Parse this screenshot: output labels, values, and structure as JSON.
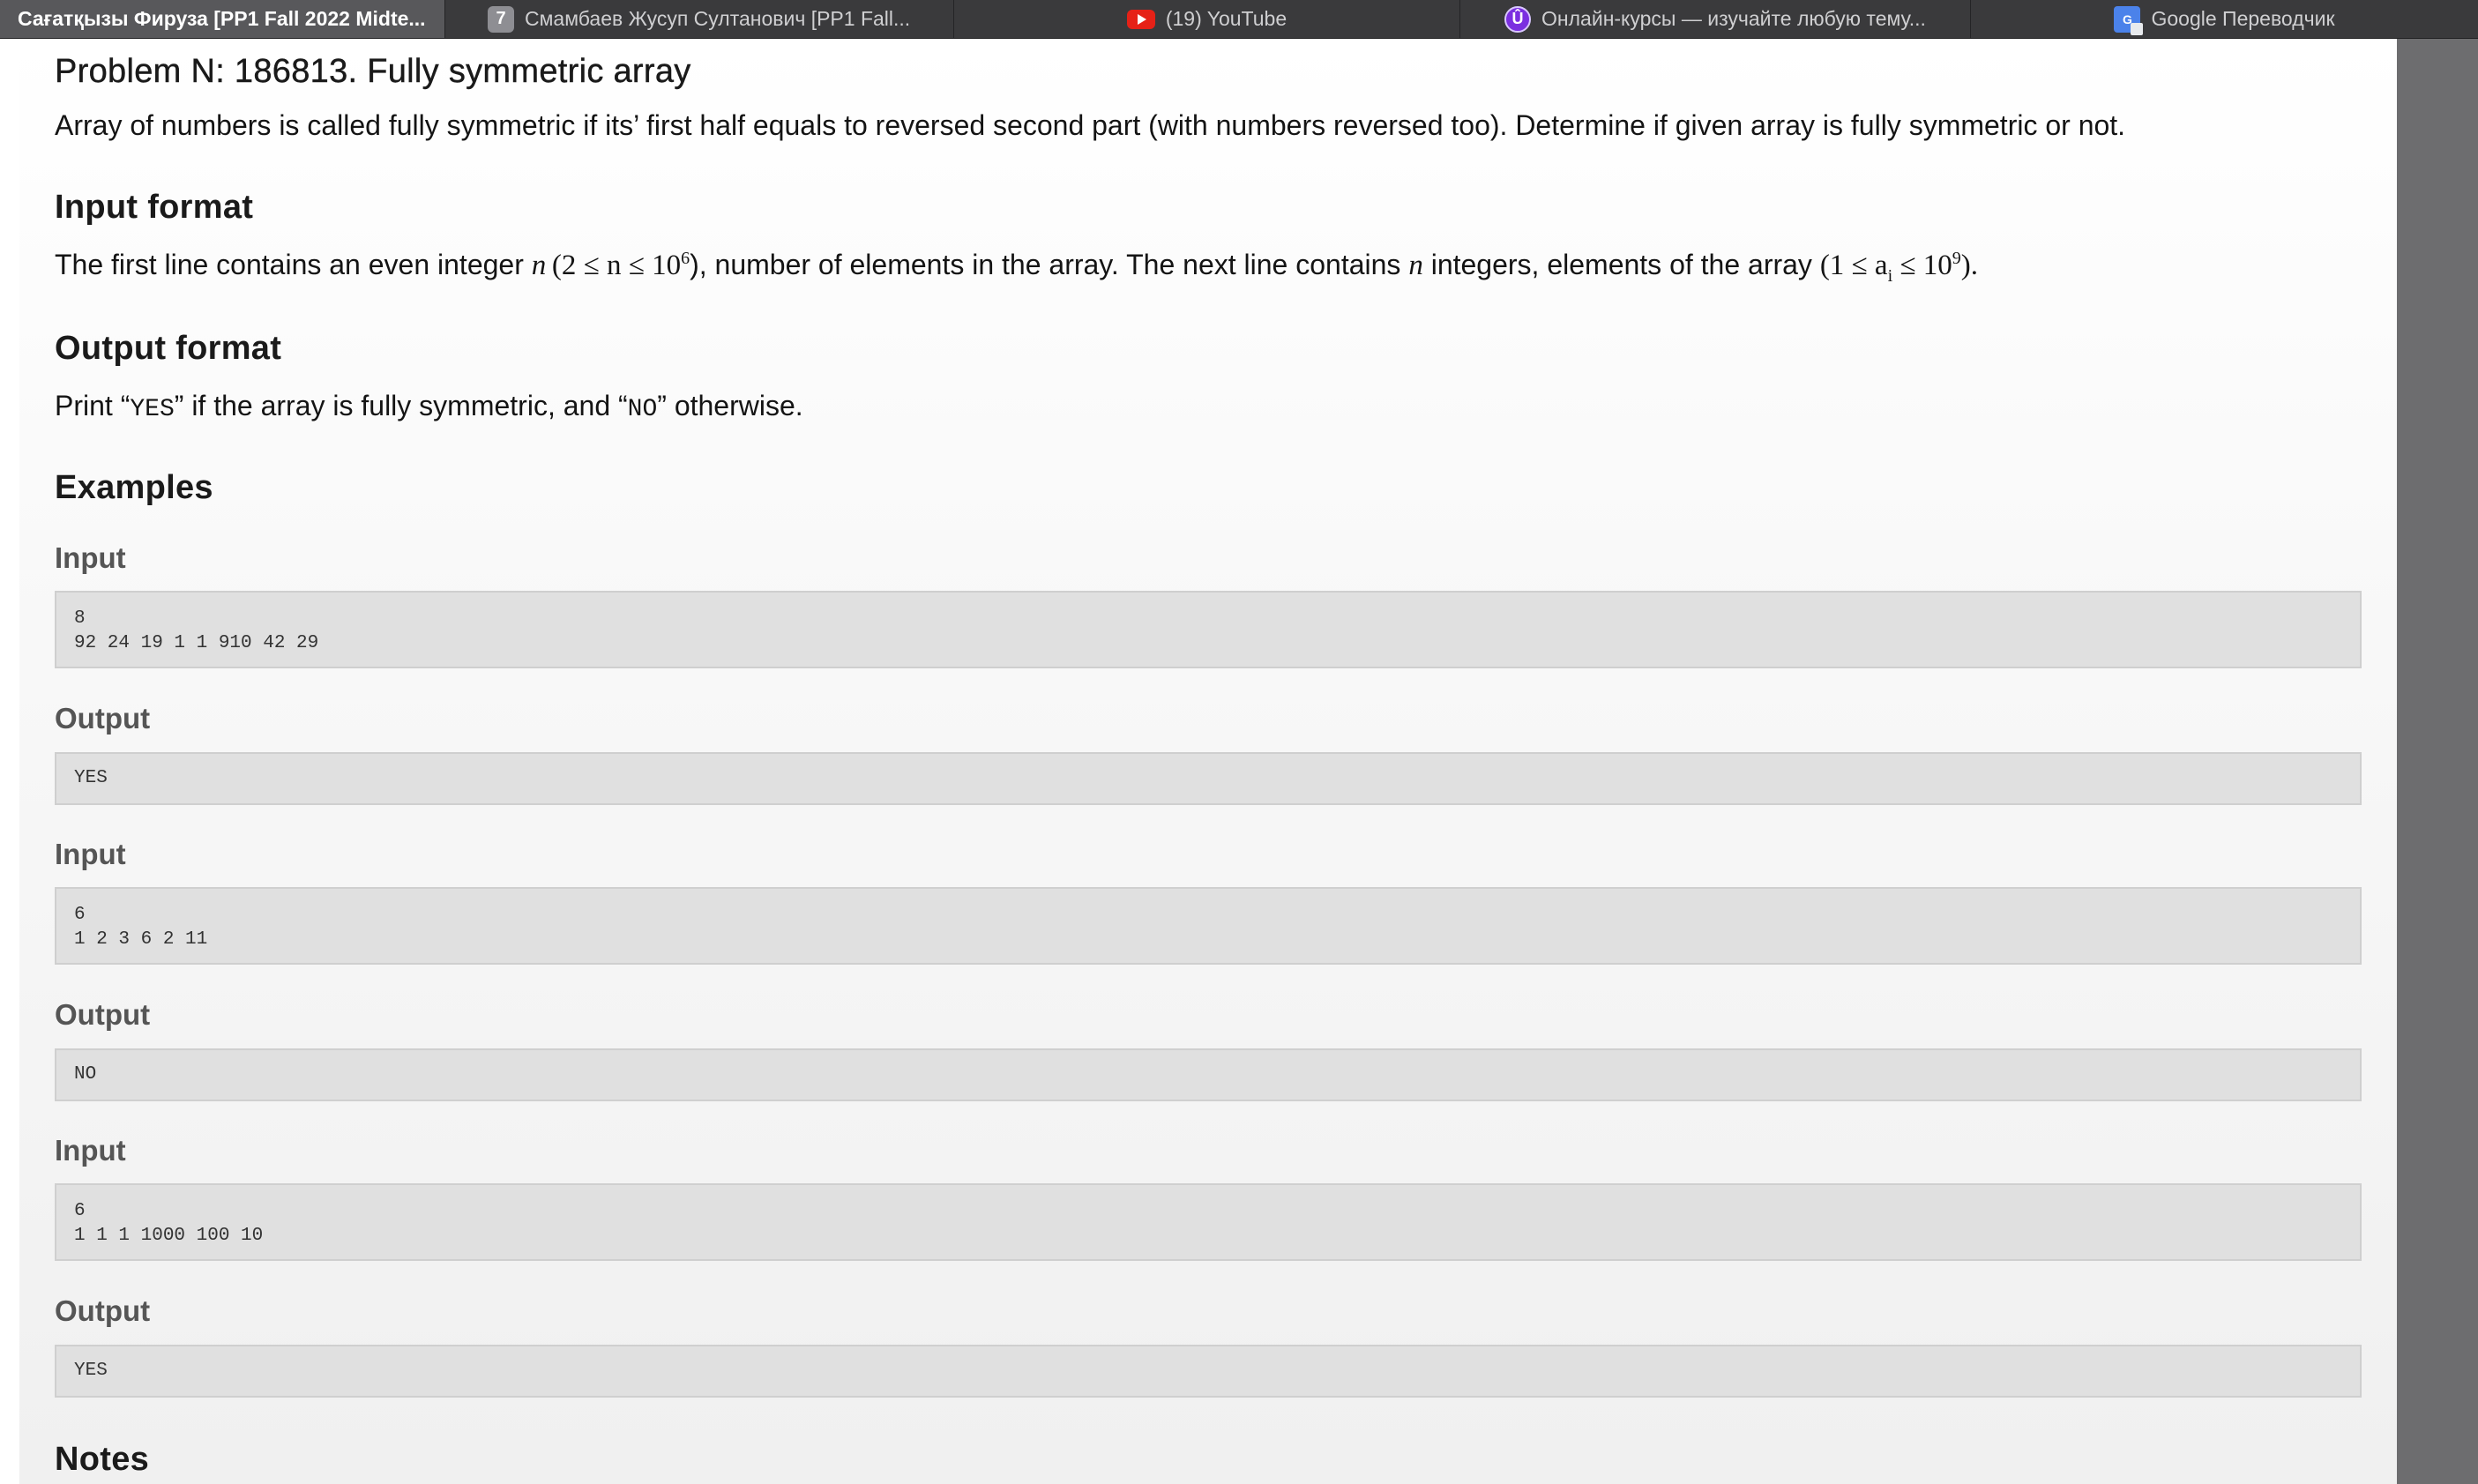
{
  "browser": {
    "tabs": [
      {
        "label": "Сағатқызы Фируза [PP1 Fall 2022 Midte...",
        "icon": "none",
        "active": true
      },
      {
        "label": "Смамбаев Жусуп Султанович [PP1 Fall...",
        "icon": "number-badge-icon",
        "badge": "7",
        "active": false
      },
      {
        "label": "(19) YouTube",
        "icon": "youtube-icon",
        "active": false
      },
      {
        "label": "Онлайн-курсы — изучайте любую тему...",
        "icon": "udemy-icon",
        "badge": "Û",
        "active": false
      },
      {
        "label": "Google Переводчик",
        "icon": "google-translate-icon",
        "badge": "G",
        "active": false
      }
    ]
  },
  "problem": {
    "title": "Problem N: 186813. Fully symmetric array",
    "statement": "Array of numbers is called fully symmetric if its’ first half equals to reversed second part (with numbers reversed too). Determine if given array is fully symmetric or not.",
    "input_heading": "Input format",
    "input_text_1": "The first line contains an even integer",
    "input_var_n": "n",
    "input_constraint_n": "(2 ≤ n ≤ 10",
    "input_exp_n": "6",
    "input_text_2": "), number of elements in the array. The next line contains",
    "input_text_3": "integers, elements of the array",
    "input_constraint_a": "(1 ≤ a",
    "input_sub_a": "i",
    "input_constraint_a2": " ≤ 10",
    "input_exp_a": "9",
    "input_text_4": ").",
    "output_heading": "Output format",
    "output_text_1": "Print “",
    "output_yes": "YES",
    "output_text_2": "” if the array is fully symmetric, and “",
    "output_no": "NO",
    "output_text_3": "” otherwise.",
    "examples_heading": "Examples",
    "input_label": "Input",
    "output_label": "Output",
    "examples": [
      {
        "input": "8\n92 24 19 1 1 910 42 29",
        "output": "YES"
      },
      {
        "input": "6\n1 2 3 6 2 11",
        "output": "NO"
      },
      {
        "input": "6\n1 1 1 1000 100 10",
        "output": "YES"
      }
    ],
    "notes_heading": "Notes"
  }
}
